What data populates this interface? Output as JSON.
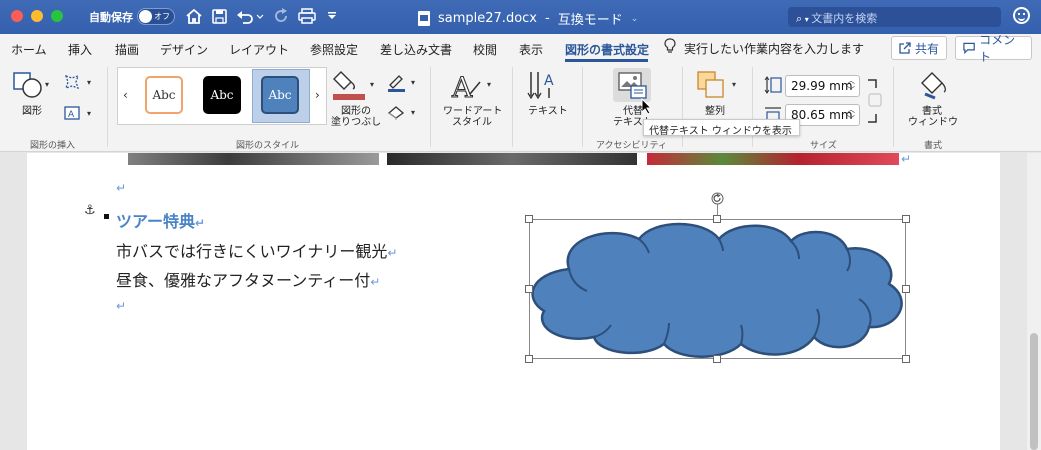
{
  "titlebar": {
    "autosave_label": "自動保存",
    "autosave_state": "オフ",
    "document_name": "sample27.docx",
    "separator": "-",
    "mode": "互換モード",
    "search_placeholder": "文書内を検索"
  },
  "tabs": [
    {
      "label": "ホーム"
    },
    {
      "label": "挿入"
    },
    {
      "label": "描画"
    },
    {
      "label": "デザイン"
    },
    {
      "label": "レイアウト"
    },
    {
      "label": "参照設定"
    },
    {
      "label": "差し込み文書"
    },
    {
      "label": "校閲"
    },
    {
      "label": "表示"
    },
    {
      "label": "図形の書式設定",
      "active": true
    }
  ],
  "tellme": "実行したい作業内容を入力します",
  "share_label": "共有",
  "comment_label": "コメント",
  "ribbon": {
    "insert_shapes": {
      "shape_label": "図形",
      "group_label": "図形の挿入"
    },
    "shape_styles": {
      "style_samples": [
        "Abc",
        "Abc",
        "Abc"
      ],
      "fill_label_1": "図形の",
      "fill_label_2": "塗りつぶし",
      "group_label": "図形のスタイル"
    },
    "wordart": {
      "label_1": "ワードアート",
      "label_2": "スタイル"
    },
    "text": {
      "label": "テキスト"
    },
    "accessibility": {
      "label_1": "代替",
      "label_2": "テキスト",
      "group_label": "アクセシビリティ"
    },
    "arrange": {
      "label": "整列"
    },
    "size": {
      "height": "29.99 mm",
      "width": "80.65 mm",
      "group_label": "サイズ"
    },
    "format": {
      "label_1": "書式",
      "label_2": "ウィンドウ",
      "group_label": "書式"
    }
  },
  "tooltip": "代替テキスト ウィンドウを表示",
  "document": {
    "heading": "ツアー特典",
    "line1": "市バスでは行きにくいワイナリー観光",
    "line2": "昼食、優雅なアフタヌーンティー付",
    "para_mark": "↵"
  },
  "colors": {
    "title_bar": "#3560ad",
    "accent": "#2b579a",
    "heading": "#4a84c8",
    "cloud_fill": "#4f81bd",
    "cloud_stroke": "#2d4f7a"
  }
}
